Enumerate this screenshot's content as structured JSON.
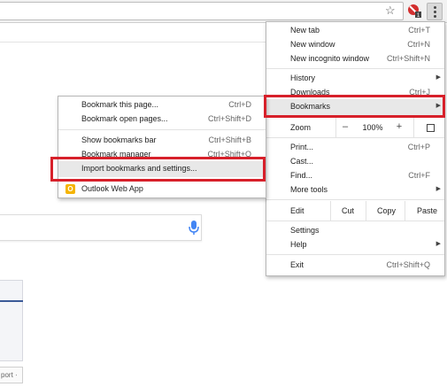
{
  "menu": {
    "items": [
      {
        "label": "New tab",
        "shortcut": "Ctrl+T"
      },
      {
        "label": "New window",
        "shortcut": "Ctrl+N"
      },
      {
        "label": "New incognito window",
        "shortcut": "Ctrl+Shift+N"
      },
      {
        "label": "History",
        "shortcut": ""
      },
      {
        "label": "Downloads",
        "shortcut": "Ctrl+J"
      },
      {
        "label": "Bookmarks",
        "shortcut": ""
      },
      {
        "label": "Print...",
        "shortcut": "Ctrl+P"
      },
      {
        "label": "Cast...",
        "shortcut": ""
      },
      {
        "label": "Find...",
        "shortcut": "Ctrl+F"
      },
      {
        "label": "More tools",
        "shortcut": ""
      },
      {
        "label": "Settings",
        "shortcut": ""
      },
      {
        "label": "Help",
        "shortcut": ""
      },
      {
        "label": "Exit",
        "shortcut": "Ctrl+Shift+Q"
      }
    ],
    "zoom": {
      "label": "Zoom",
      "minus": "–",
      "value": "100%",
      "plus": "+"
    },
    "edit": {
      "label": "Edit",
      "cut": "Cut",
      "copy": "Copy",
      "paste": "Paste"
    }
  },
  "bookmarks_submenu": {
    "items": [
      {
        "label": "Bookmark this page...",
        "shortcut": "Ctrl+D"
      },
      {
        "label": "Bookmark open pages...",
        "shortcut": "Ctrl+Shift+D"
      },
      {
        "label": "Show bookmarks bar",
        "shortcut": "Ctrl+Shift+B"
      },
      {
        "label": "Bookmark manager",
        "shortcut": "Ctrl+Shift+O"
      },
      {
        "label": "Import bookmarks and settings...",
        "shortcut": ""
      },
      {
        "label": "Outlook Web App",
        "shortcut": ""
      }
    ],
    "outlook_icon_letter": "O"
  },
  "page": {
    "import_button": "port ·"
  },
  "colors": {
    "highlight_border": "#d7202a",
    "menu_hover": "#e8e8e8",
    "outlook_icon": "#f5b400",
    "mic_blue": "#4285f4",
    "panel_accent": "#3b5a98"
  }
}
